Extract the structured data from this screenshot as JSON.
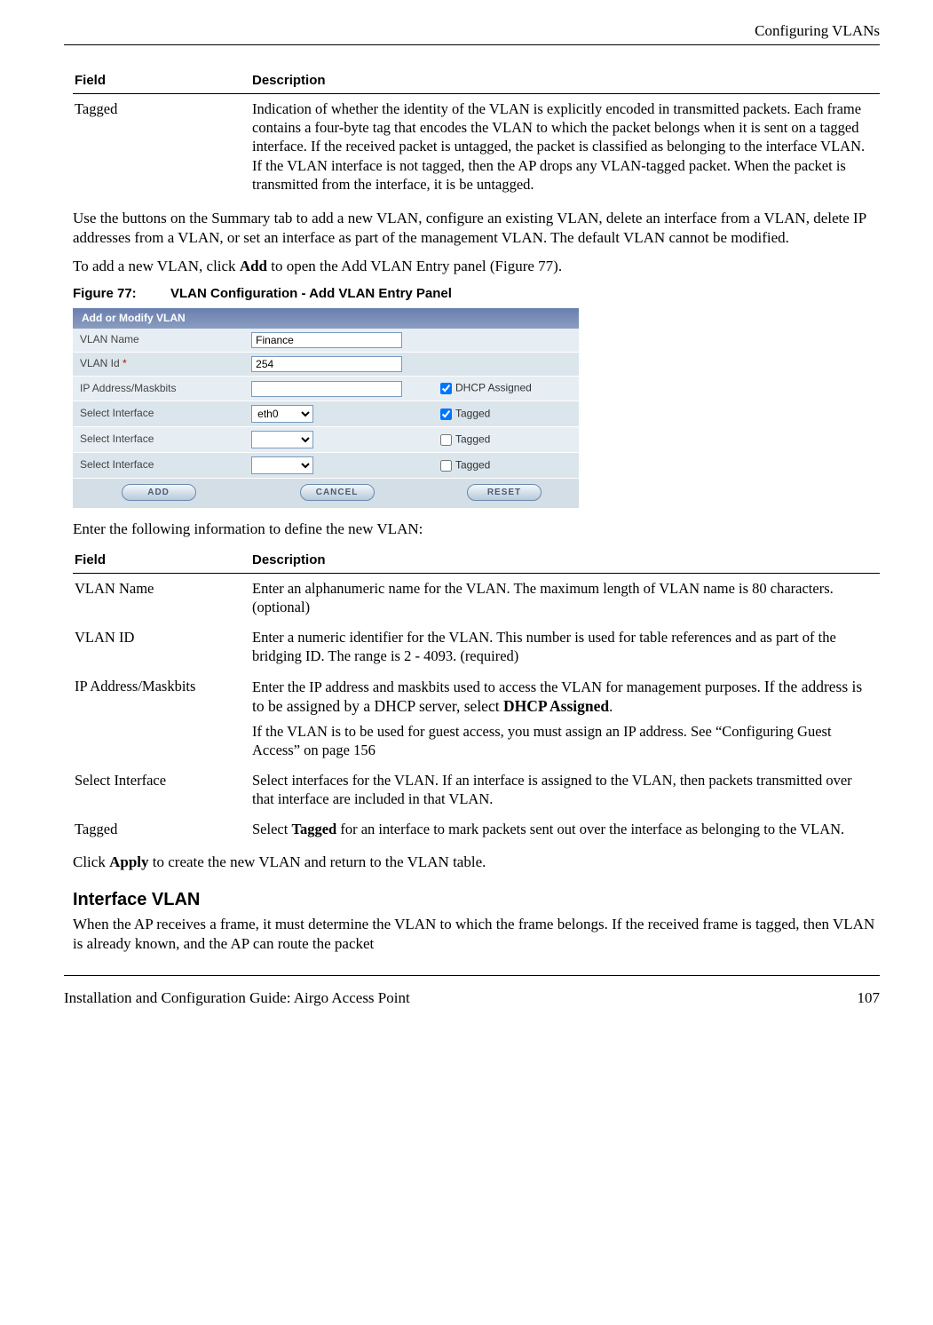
{
  "header": {
    "section_title": "Configuring VLANs"
  },
  "table1": {
    "head_field": "Field",
    "head_desc": "Description",
    "rows": [
      {
        "field": "Tagged",
        "desc": "Indication of whether the identity of the VLAN is explicitly encoded in transmitted packets. Each frame contains a four-byte tag that encodes the VLAN to which the packet belongs when it is sent on a tagged interface. If the received packet is untagged, the packet is classified as belonging to the interface VLAN. If the VLAN interface is not tagged, then the AP drops any VLAN-tagged packet. When the packet is transmitted from the interface, it is be untagged."
      }
    ]
  },
  "para1": "Use the buttons on the Summary tab to add a new VLAN, configure an existing VLAN, delete an interface from a VLAN, delete IP addresses from a VLAN, or set an interface as part of the management VLAN. The default VLAN cannot be modified.",
  "para2_pre": "To add a new VLAN, click ",
  "para2_bold": "Add",
  "para2_post": " to open the Add VLAN Entry panel (Figure 77).",
  "figcap": {
    "num": "Figure 77:",
    "text": "VLAN Configuration - Add VLAN Entry Panel"
  },
  "panel": {
    "title": "Add or Modify VLAN",
    "rows": {
      "vlan_name_label": "VLAN Name",
      "vlan_name_value": "Finance",
      "vlan_id_label": "VLAN Id",
      "vlan_id_required": "*",
      "vlan_id_value": "254",
      "ip_label": "IP Address/Maskbits",
      "ip_value": "",
      "dhcp_label": "DHCP Assigned",
      "dhcp_checked": true,
      "si_label": "Select Interface",
      "if1_value": "eth0",
      "if1_tagged": true,
      "if2_value": "",
      "if2_tagged": false,
      "if3_value": "",
      "if3_tagged": false,
      "tagged_label": "Tagged"
    },
    "buttons": {
      "add": "ADD",
      "cancel": "CANCEL",
      "reset": "RESET"
    }
  },
  "para3": "Enter the following information to define the new VLAN:",
  "table2": {
    "head_field": "Field",
    "head_desc": "Description",
    "rows": {
      "r1_field": "VLAN Name",
      "r1_desc": "Enter an alphanumeric name for the VLAN. The maximum length of VLAN name is 80 characters. (optional)",
      "r2_field": "VLAN ID",
      "r2_desc": "Enter a numeric identifier for the VLAN. This number is used for table references and as part of the bridging ID. The range is 2 - 4093. (required)",
      "r3_field": "IP Address/Maskbits",
      "r3_desc_pre": "Enter the IP address and maskbits used to access the VLAN for management purposes. ",
      "r3_desc_mid": "If the address is to be assigned by a DHCP server, select ",
      "r3_desc_bold": "DHCP Assigned",
      "r3_desc_period": ".",
      "r3_desc_p2": "If the VLAN is to be used for guest access, you must assign an IP address. See “Configuring Guest Access” on page 156",
      "r4_field": "Select Interface",
      "r4_desc": "Select interfaces for the VLAN. If an interface is assigned to the VLAN, then packets transmitted over that interface are included in that VLAN.",
      "r5_field": "Tagged",
      "r5_desc_pre": "Select ",
      "r5_desc_bold": "Tagged",
      "r5_desc_post": " for an interface to mark packets sent out over the interface as belonging to the VLAN."
    }
  },
  "para4_pre": "Click ",
  "para4_bold": "Apply",
  "para4_post": " to create the new VLAN and return to the VLAN table.",
  "subhead": "Interface VLAN",
  "para5": "When the AP receives a frame, it must determine the VLAN to which the frame belongs. If the received frame is tagged, then VLAN is already known, and the AP can route the packet",
  "footer": {
    "left": "Installation and Configuration Guide: Airgo Access Point",
    "right": "107"
  }
}
